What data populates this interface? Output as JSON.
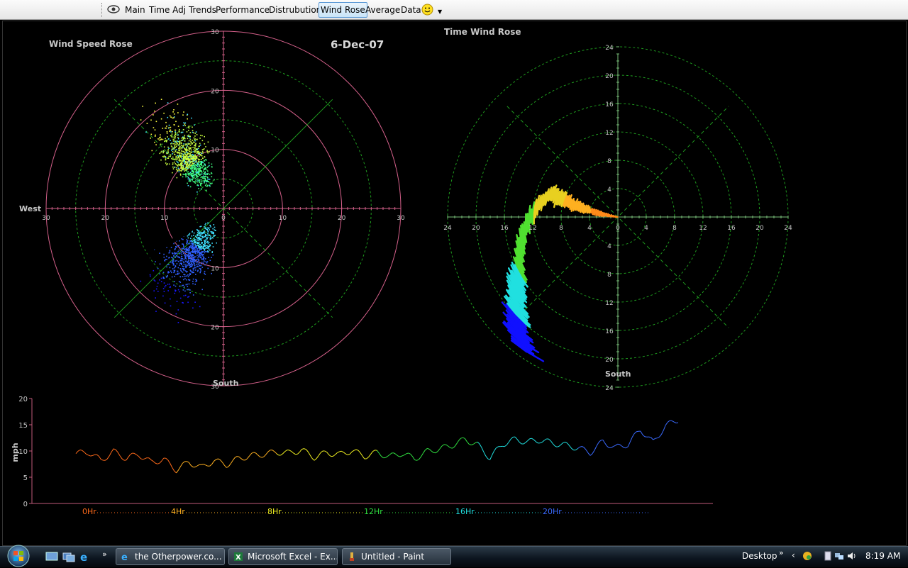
{
  "toolbar": {
    "icons": [
      "eye-icon",
      "smiley-icon"
    ],
    "tabs": [
      {
        "label": "Main",
        "active": false
      },
      {
        "label": "Time Adj Trends",
        "active": false
      },
      {
        "label": "Performance",
        "active": false
      },
      {
        "label": "Distrubution",
        "active": false
      },
      {
        "label": "Wind Rose",
        "active": true
      },
      {
        "label": "Average",
        "active": false
      },
      {
        "label": "Data",
        "active": false
      }
    ]
  },
  "date_label": "6-Dec-07",
  "chart_data": [
    {
      "type": "scatter",
      "title": "Wind Speed Rose",
      "projection": "polar",
      "radial_range": [
        0,
        30
      ],
      "radial_ticks": [
        10,
        20,
        30
      ],
      "axis_labels": {
        "west": "West",
        "south": "South"
      },
      "grid": true,
      "colors": [
        "#ffff40",
        "#c8ff40",
        "#40ff80",
        "#40e0ff",
        "#3060ff",
        "#1818ff"
      ]
    },
    {
      "type": "line",
      "title": "Time Wind Rose",
      "projection": "polar",
      "radial_range": [
        0,
        24
      ],
      "radial_ticks": [
        4,
        8,
        12,
        16,
        20,
        24
      ],
      "axis_labels": {
        "south": "South"
      },
      "grid": true,
      "colors": [
        "#ff8a1a",
        "#ffb020",
        "#e8d020",
        "#50e030",
        "#20e0e0",
        "#1010ff"
      ]
    },
    {
      "type": "line",
      "ylabel": "mph",
      "ylim": [
        0,
        20
      ],
      "yticks": [
        0,
        5,
        10,
        15,
        20
      ],
      "hour_labels": [
        {
          "label": "0Hr",
          "color": "#ff6a1a"
        },
        {
          "label": "4Hr",
          "color": "#ffb020"
        },
        {
          "label": "8Hr",
          "color": "#f0f020"
        },
        {
          "label": "12Hr",
          "color": "#30e040"
        },
        {
          "label": "16Hr",
          "color": "#20e0e0"
        },
        {
          "label": "20Hr",
          "color": "#3a6aff"
        }
      ],
      "x": [
        0,
        0.5,
        1,
        1.5,
        2,
        2.5,
        3,
        3.5,
        4,
        4.5,
        5,
        5.5,
        6,
        6.5,
        7,
        7.5,
        8,
        8.5,
        9,
        9.5,
        10,
        10.5,
        11,
        11.5,
        12,
        12.5,
        13,
        13.5,
        14,
        14.5,
        15,
        15.5,
        16,
        16.5,
        17,
        17.5,
        18,
        18.5,
        19,
        19.5,
        20,
        20.5,
        21,
        21.5,
        22,
        22.5,
        23,
        23.5,
        24
      ],
      "values": [
        9.5,
        9.8,
        8.2,
        9.9,
        8.6,
        9.4,
        7.8,
        8.4,
        6.4,
        7.9,
        6.8,
        8.2,
        7.4,
        8.6,
        9.1,
        9.4,
        9.8,
        9.6,
        10.2,
        8.8,
        9.7,
        9.3,
        10.1,
        9.0,
        9.7,
        8.9,
        9.6,
        8.5,
        9.9,
        10.4,
        11.1,
        12.2,
        11.2,
        8.7,
        11.3,
        12.2,
        11.7,
        12.1,
        11.5,
        11.1,
        10.6,
        9.7,
        11.8,
        10.6,
        11.3,
        14.1,
        11.6,
        14.8,
        16.0
      ]
    }
  ],
  "taskbar": {
    "quick_launch_icons": [
      "show-desktop-icon",
      "switch-windows-icon",
      "ie-icon"
    ],
    "windows": [
      {
        "label": "the Otherpower.co...",
        "icon": "ie-icon"
      },
      {
        "label": "Microsoft Excel - Ex...",
        "icon": "excel-icon"
      },
      {
        "label": "Untitled - Paint",
        "icon": "paint-icon"
      }
    ],
    "desktop_label": "Desktop",
    "clock": "8:19 AM"
  }
}
